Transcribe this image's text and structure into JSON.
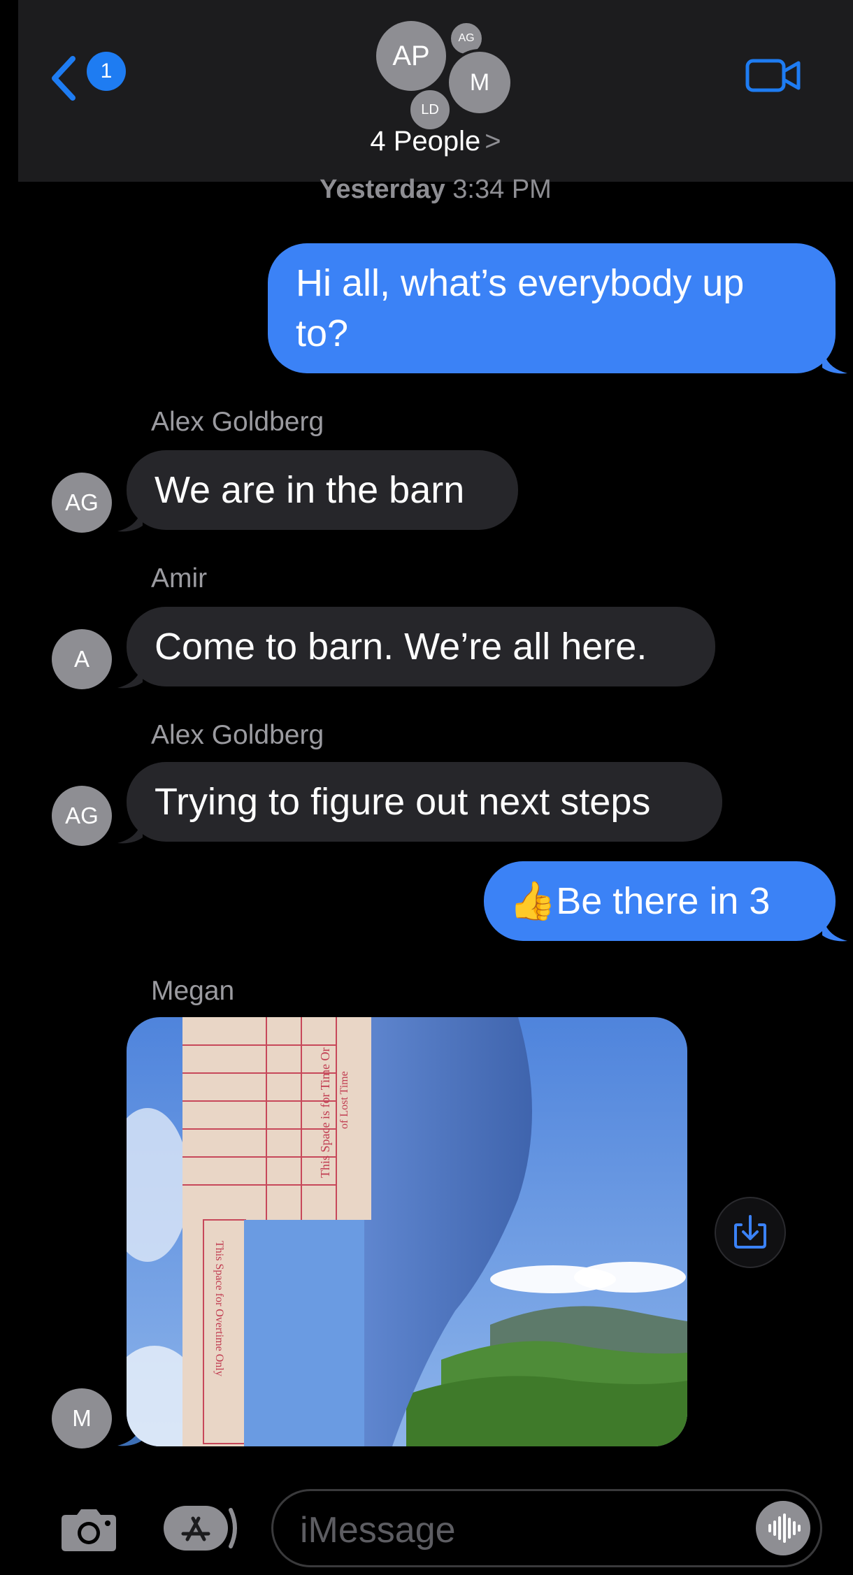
{
  "header": {
    "back_badge": "1",
    "avatars": {
      "main": "AP",
      "small": "AG",
      "m": "M",
      "ld": "LD"
    },
    "group_name": "4 People",
    "chevron": ">"
  },
  "timestamp": {
    "day": "Yesterday",
    "time": "3:34 PM"
  },
  "messages": [
    {
      "type": "outgoing",
      "lines": [
        "Hi all, what’s everybody up",
        "to?"
      ]
    },
    {
      "type": "incoming",
      "sender": "Alex Goldberg",
      "avatar": "AG",
      "text": "We are in the barn"
    },
    {
      "type": "incoming",
      "sender": "Amir",
      "avatar": "A",
      "text": "Come to barn. We’re all here."
    },
    {
      "type": "incoming",
      "sender": "Alex Goldberg",
      "avatar": "AG",
      "text": "Trying to figure out next steps"
    },
    {
      "type": "outgoing",
      "emoji": "👍",
      "text": "Be there in 3"
    },
    {
      "type": "incoming-photo",
      "sender": "Megan",
      "avatar": "M",
      "photo_texts": [
        "This Space is for Time Or",
        "of Lost Time",
        "This Space for Overtime Only"
      ]
    }
  ],
  "composer": {
    "placeholder": "iMessage"
  },
  "icons": [
    "back-chevron-icon",
    "video-camera-icon",
    "download-icon",
    "camera-icon",
    "app-store-icon",
    "audio-waveform-icon"
  ],
  "colors": {
    "outgoing_bubble": "#3b82f6",
    "incoming_bubble": "#26262a",
    "header_bg": "#1c1c1e",
    "badge": "#1e7cf2"
  }
}
